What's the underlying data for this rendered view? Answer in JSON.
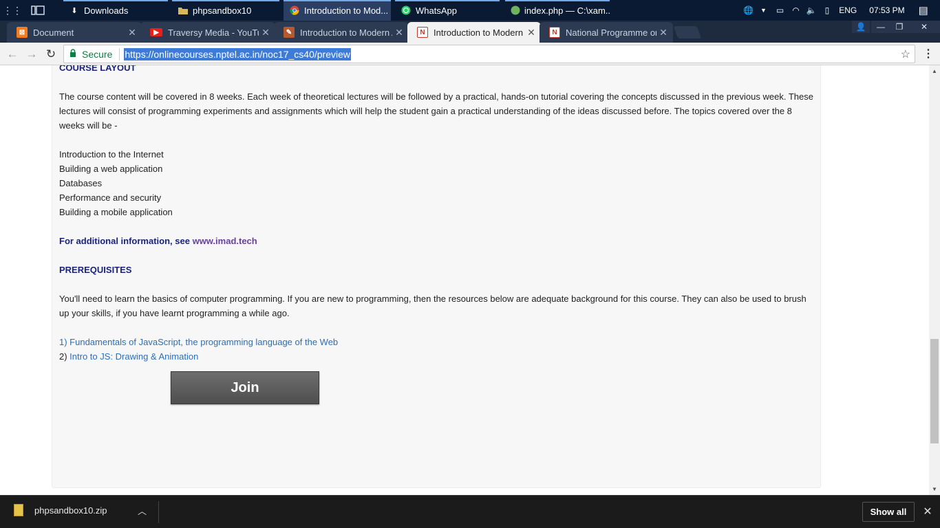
{
  "taskbar": {
    "apps": [
      {
        "label": "Downloads",
        "icon": "download-arrow-icon"
      },
      {
        "label": "phpsandbox10",
        "icon": "folder-icon"
      },
      {
        "label": "Introduction to Mod...",
        "icon": "chrome-icon"
      },
      {
        "label": "WhatsApp",
        "icon": "whatsapp-icon"
      },
      {
        "label": "index.php — C:\\xam...",
        "icon": "editor-icon"
      }
    ],
    "tray": {
      "lang": "ENG",
      "time": "07:53 PM"
    }
  },
  "tabs": [
    {
      "title": "Document",
      "icon": "xampp-icon"
    },
    {
      "title": "Traversy Media - YouTube",
      "icon": "youtube-icon"
    },
    {
      "title": "Introduction to Modern Application Development",
      "icon": "course-icon"
    },
    {
      "title": "Introduction to Modern Application Development",
      "icon": "nptel-icon"
    },
    {
      "title": "National Programme on Technology Enhanced Learning",
      "icon": "nptel-icon"
    }
  ],
  "address": {
    "secure_label": "Secure",
    "url": "https://onlinecourses.nptel.ac.in/noc17_cs40/preview"
  },
  "page": {
    "layout_heading": "COURSE LAYOUT",
    "intro": "The course content will be covered in 8 weeks. Each week of theoretical lectures will be followed by a practical, hands-on tutorial covering the concepts discussed in the previous week. These lectures will consist of programming experiments and assignments which will help the student gain a practical understanding of the ideas discussed before. The topics covered over the 8 weeks will be -",
    "topics": [
      "Introduction to the Internet",
      "Building a web application",
      "Databases",
      "Performance and security",
      "Building a mobile application"
    ],
    "additional_prefix": "For additional information, see ",
    "additional_link": "www.imad.tech",
    "prereq_heading": "PREREQUISITES",
    "prereq_text": "You'll need to learn the basics of computer programming. If you are new to programming, then the resources below are adequate background for this course. They can also be used to brush up your skills, if you have learnt programming a while ago.",
    "resources": [
      {
        "num": "1) ",
        "label": "Fundamentals of JavaScript, the programming language of the Web"
      },
      {
        "num": "2) ",
        "label": "Intro to JS: Drawing & Animation"
      }
    ],
    "join_label": "Join"
  },
  "downloads": {
    "file": "phpsandbox10.zip",
    "show_all": "Show all"
  }
}
